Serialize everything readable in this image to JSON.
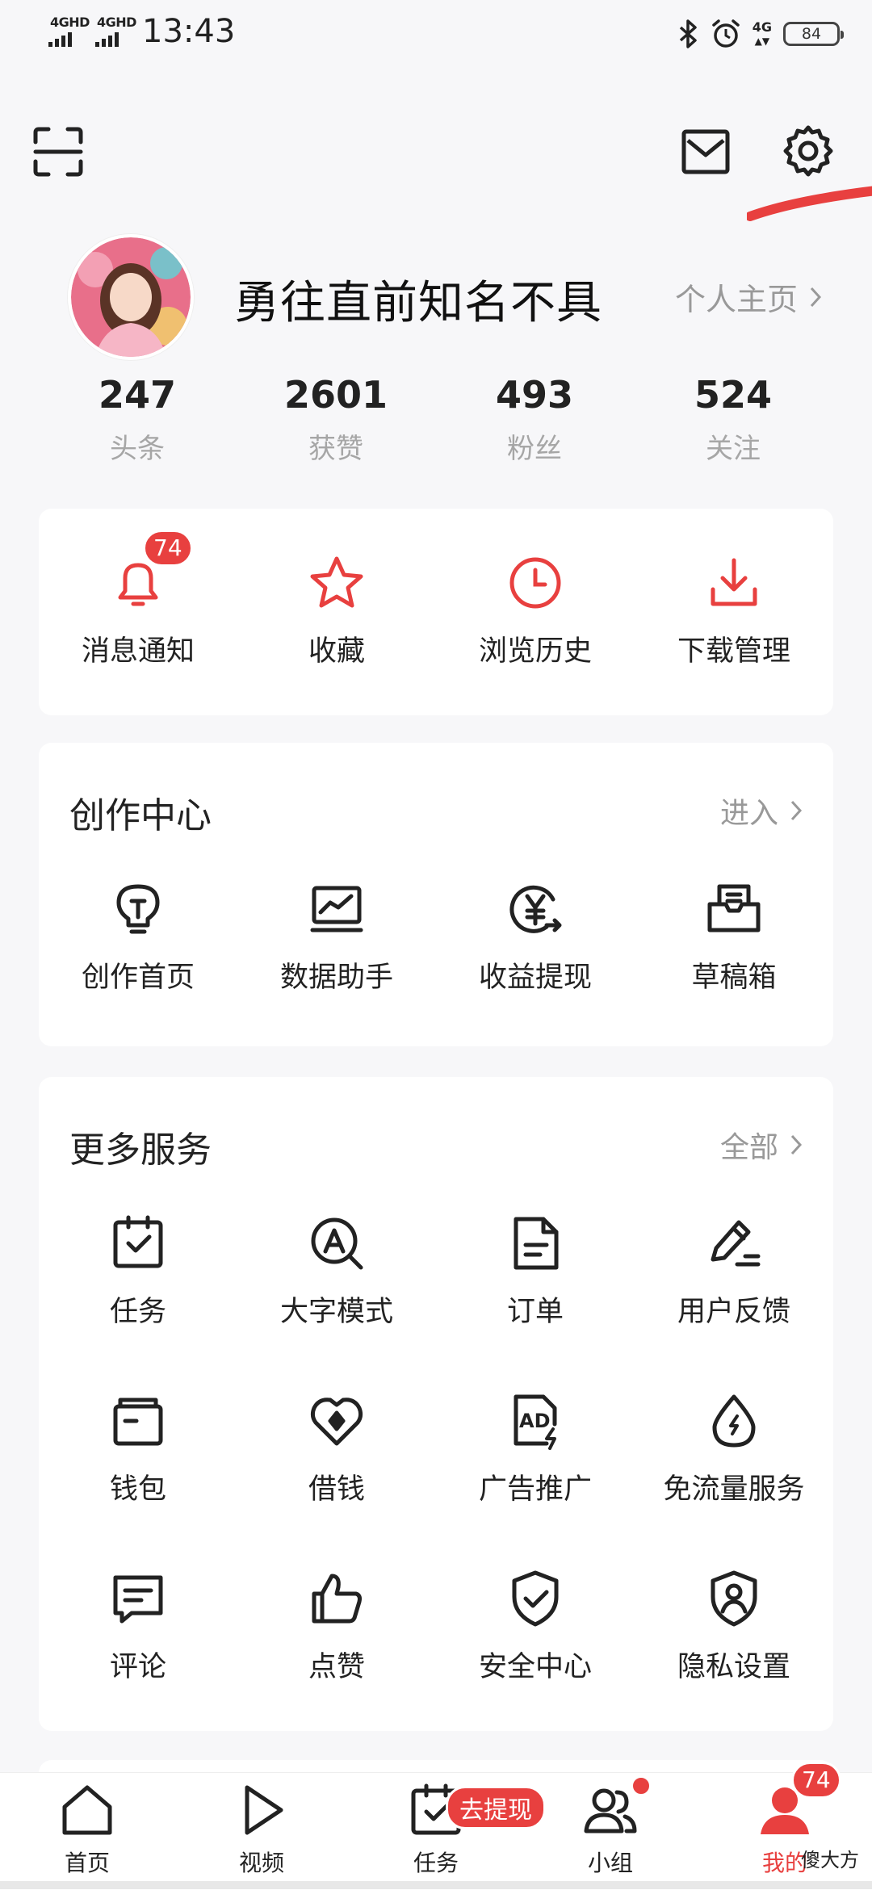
{
  "status_bar": {
    "sim1": "4GHD",
    "sim2": "4GHD",
    "time": "13:43",
    "net": "4G",
    "battery": "84",
    "icons": [
      "bluetooth-icon",
      "alarm-icon",
      "network-4g-icon",
      "battery-icon"
    ]
  },
  "header": {
    "icons": [
      "scan-icon",
      "mail-icon",
      "gear-icon"
    ]
  },
  "profile": {
    "name": "勇往直前知名不具",
    "homepage_label": "个人主页"
  },
  "stats": [
    {
      "value": "247",
      "label": "头条"
    },
    {
      "value": "2601",
      "label": "获赞"
    },
    {
      "value": "493",
      "label": "粉丝"
    },
    {
      "value": "524",
      "label": "关注"
    }
  ],
  "quick_actions": [
    {
      "label": "消息通知",
      "icon": "bell-icon",
      "badge": "74"
    },
    {
      "label": "收藏",
      "icon": "star-icon"
    },
    {
      "label": "浏览历史",
      "icon": "clock-icon"
    },
    {
      "label": "下载管理",
      "icon": "download-icon"
    }
  ],
  "creation_center": {
    "title": "创作中心",
    "link": "进入",
    "items": [
      {
        "label": "创作首页",
        "icon": "lightbulb-icon"
      },
      {
        "label": "数据助手",
        "icon": "chart-icon"
      },
      {
        "label": "收益提现",
        "icon": "yen-icon"
      },
      {
        "label": "草稿箱",
        "icon": "drafts-icon"
      }
    ]
  },
  "more_services": {
    "title": "更多服务",
    "link": "全部",
    "items": [
      {
        "label": "任务",
        "icon": "task-icon"
      },
      {
        "label": "大字模式",
        "icon": "large-text-icon"
      },
      {
        "label": "订单",
        "icon": "order-icon"
      },
      {
        "label": "用户反馈",
        "icon": "feedback-icon"
      },
      {
        "label": "钱包",
        "icon": "wallet-icon"
      },
      {
        "label": "借钱",
        "icon": "loan-icon"
      },
      {
        "label": "广告推广",
        "icon": "ad-icon"
      },
      {
        "label": "免流量服务",
        "icon": "data-free-icon"
      },
      {
        "label": "评论",
        "icon": "comment-icon"
      },
      {
        "label": "点赞",
        "icon": "thumbs-up-icon"
      },
      {
        "label": "安全中心",
        "icon": "shield-icon"
      },
      {
        "label": "隐私设置",
        "icon": "privacy-icon"
      }
    ]
  },
  "bottom_nav": {
    "items": [
      {
        "label": "首页",
        "icon": "home-icon"
      },
      {
        "label": "视频",
        "icon": "play-icon"
      },
      {
        "label": "任务",
        "icon": "task-icon"
      },
      {
        "label": "小组",
        "icon": "group-icon"
      },
      {
        "label": "我的",
        "icon": "profile-icon",
        "badge": "74"
      }
    ],
    "withdraw_pill": "去提现",
    "watermark": "傻大方"
  },
  "colors": {
    "accent": "#e8403f",
    "background": "#f7f7f9"
  }
}
